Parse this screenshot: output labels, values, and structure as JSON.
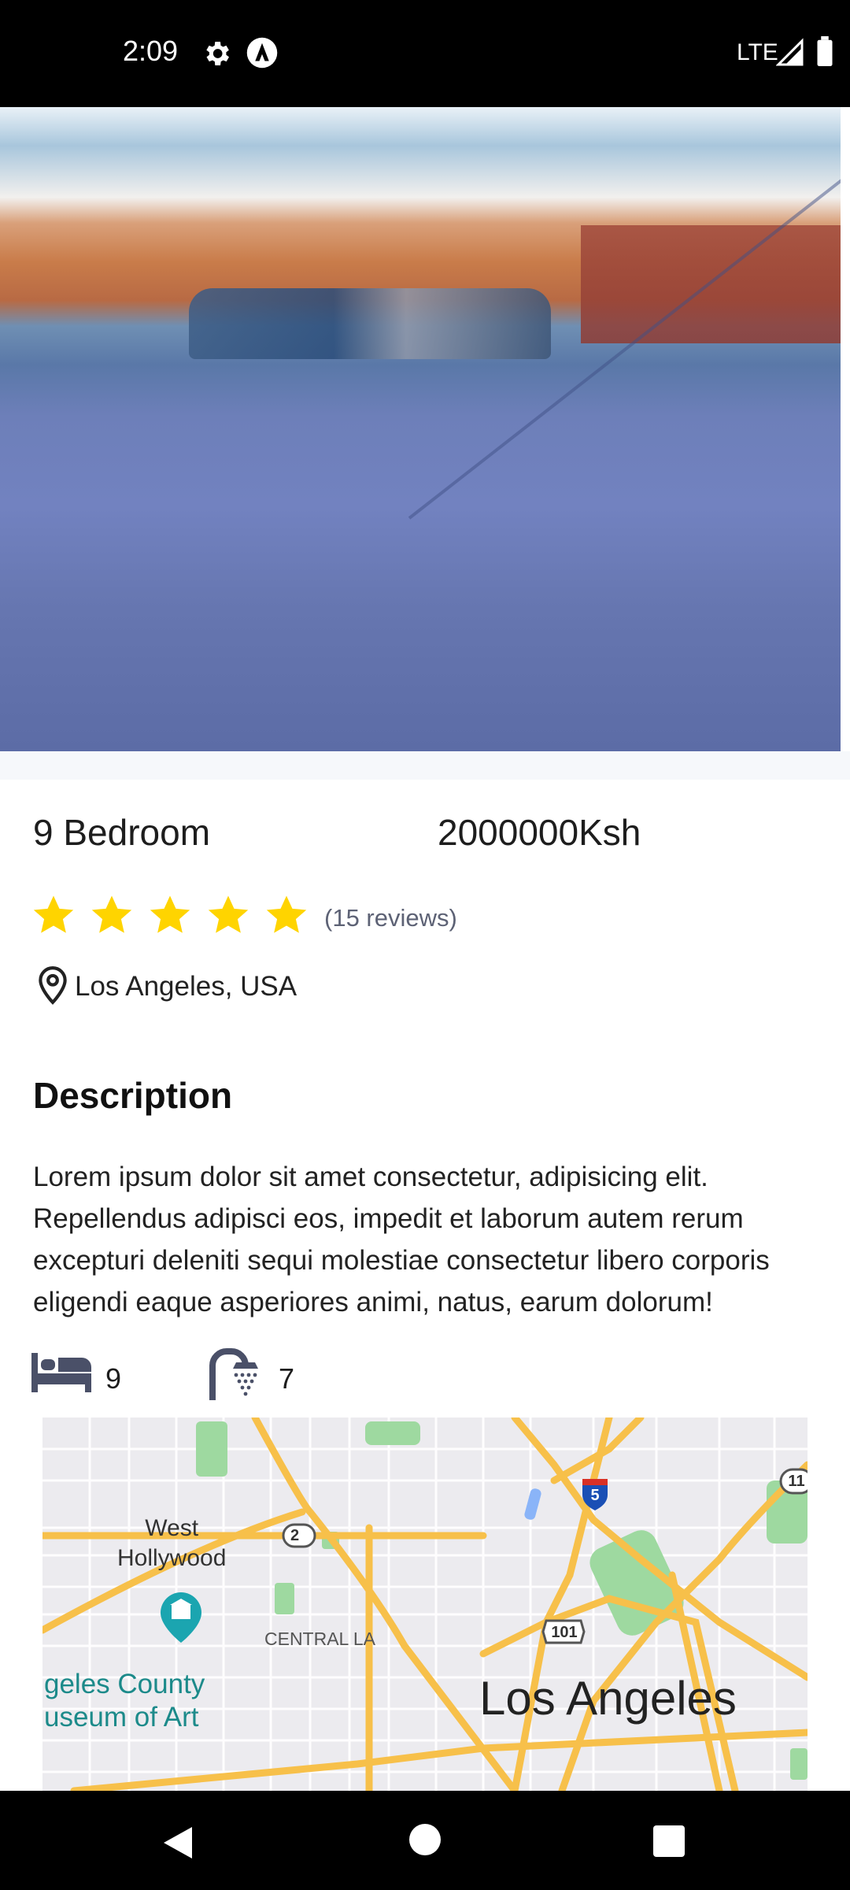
{
  "status_bar": {
    "time": "2:09",
    "network": "LTE",
    "icons": [
      "gear-icon",
      "app-a-icon",
      "signal-icon",
      "battery-icon"
    ]
  },
  "listing": {
    "title": "9 Bedroom",
    "price": "2000000Ksh",
    "rating_stars": 5,
    "reviews": "(15 reviews)",
    "location": "Los Angeles, USA"
  },
  "description": {
    "heading": "Description",
    "text": "Lorem ipsum dolor sit amet consectetur, adipisicing elit. Repellendus adipisci eos, impedit et laborum autem rerum excepturi deleniti sequi molestiae consectetur libero corporis eligendi eaque asperiores animi, natus, earum dolorum!"
  },
  "amenities": {
    "bedrooms": "9",
    "bathrooms": "7"
  },
  "map": {
    "labels": {
      "west_hollywood_1": "West",
      "west_hollywood_2": "Hollywood",
      "central": "CENTRAL LA",
      "museum_1": "geles County",
      "museum_2": "useum of Art",
      "city": "Los Angeles"
    },
    "shields": {
      "route_2": "2",
      "i5": "5",
      "us101": "101",
      "route_11": "11"
    }
  },
  "colors": {
    "star": "#FFD400",
    "icon_dark": "#4a5068",
    "road": "#F7C04A",
    "park": "#9ed9a0"
  }
}
